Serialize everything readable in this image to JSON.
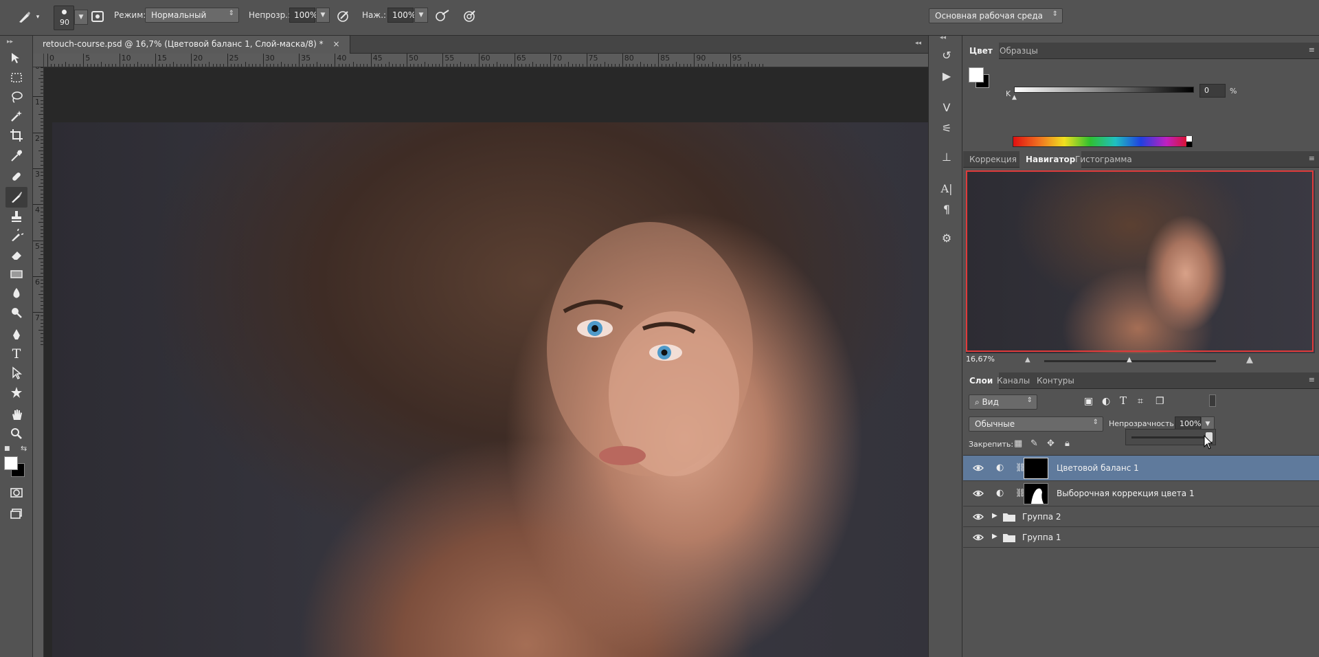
{
  "options_bar": {
    "brush_size": "90",
    "mode_label": "Режим:",
    "mode_value": "Нормальный",
    "opacity_label": "Непрозр.:",
    "opacity_value": "100%",
    "flow_label": "Наж.:",
    "flow_value": "100%",
    "workspace_value": "Основная рабочая среда"
  },
  "document": {
    "tab_title": "retouch-course.psd @ 16,7% (Цветовой баланс 1, Слой-маска/8) *",
    "close_glyph": "×",
    "ruler_top_ticks": [
      "0",
      "5",
      "10",
      "15",
      "20",
      "25",
      "30",
      "35",
      "40",
      "45",
      "50",
      "55",
      "60",
      "65",
      "70",
      "75",
      "80",
      "85",
      "90",
      "95"
    ],
    "ruler_left_ticks": [
      "0",
      "1",
      "2",
      "3",
      "4",
      "5",
      "6",
      "7"
    ]
  },
  "color_panel": {
    "tabs": [
      "Цвет",
      "Образцы"
    ],
    "active_tab": "Цвет",
    "k_label": "K",
    "k_value": "0",
    "percent": "%"
  },
  "navigator_panel": {
    "tabs": [
      "Коррекция",
      "Навигатор",
      "Гистограмма"
    ],
    "active_tab": "Навигатор",
    "zoom_value": "16,67%",
    "view_frame_color": "#e03a3a"
  },
  "layers_panel": {
    "tabs": [
      "Слои",
      "Каналы",
      "Контуры"
    ],
    "active_tab": "Слои",
    "filter_value": "Вид",
    "blend_mode": "Обычные",
    "opacity_label": "Непрозрачность:",
    "opacity_value": "100%",
    "lock_label": "Закрепить:",
    "layers": [
      {
        "name": "Цветовой баланс 1",
        "selected": true,
        "type": "adjustment"
      },
      {
        "name": "Выборочная коррекция цвета 1",
        "selected": false,
        "type": "adjustment"
      },
      {
        "name": "Группа 2",
        "selected": false,
        "type": "group"
      },
      {
        "name": "Группа 1",
        "selected": false,
        "type": "group"
      }
    ]
  },
  "colors": {
    "bg": "#535353",
    "selected_layer": "#5f7a9c",
    "canvas_bg": "#282828"
  }
}
